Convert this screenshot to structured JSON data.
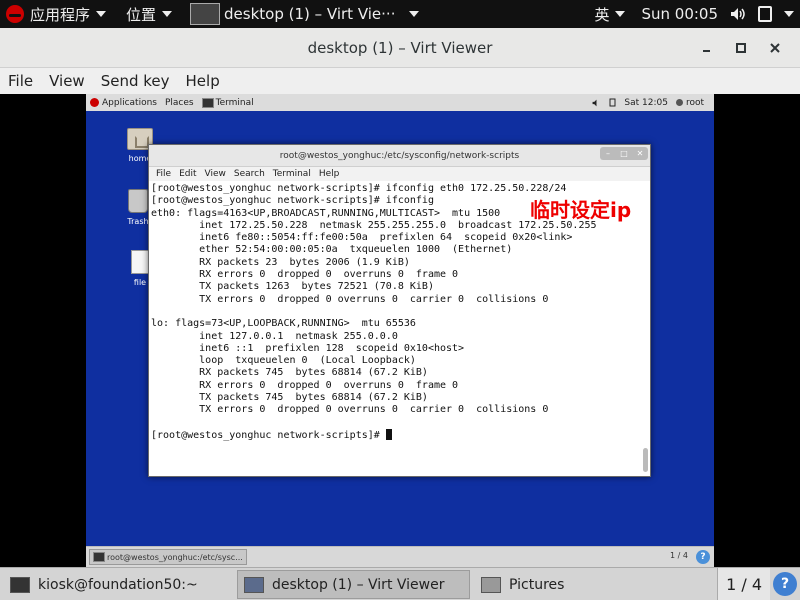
{
  "host_top": {
    "applications": "应用程序",
    "places": "位置",
    "window_title": "desktop (1) – Virt Vie···",
    "input_method": "英",
    "clock": "Sun 00:05"
  },
  "viewer": {
    "title": "desktop (1) – Virt Viewer",
    "menu": [
      "File",
      "View",
      "Send key",
      "Help"
    ]
  },
  "guest_top": {
    "applications": "Applications",
    "places": "Places",
    "task": "Terminal",
    "clock": "Sat 12:05",
    "user": "root"
  },
  "desktop_icons": [
    "home",
    "Trash",
    "file"
  ],
  "terminal": {
    "title": "root@westos_yonghuc:/etc/sysconfig/network-scripts",
    "menu": [
      "File",
      "Edit",
      "View",
      "Search",
      "Terminal",
      "Help"
    ],
    "lines": [
      "[root@westos_yonghuc network-scripts]# ifconfig eth0 172.25.50.228/24",
      "[root@westos_yonghuc network-scripts]# ifconfig",
      "eth0: flags=4163<UP,BROADCAST,RUNNING,MULTICAST>  mtu 1500",
      "        inet 172.25.50.228  netmask 255.255.255.0  broadcast 172.25.50.255",
      "        inet6 fe80::5054:ff:fe00:50a  prefixlen 64  scopeid 0x20<link>",
      "        ether 52:54:00:00:05:0a  txqueuelen 1000  (Ethernet)",
      "        RX packets 23  bytes 2006 (1.9 KiB)",
      "        RX errors 0  dropped 0  overruns 0  frame 0",
      "        TX packets 1263  bytes 72521 (70.8 KiB)",
      "        TX errors 0  dropped 0 overruns 0  carrier 0  collisions 0",
      "",
      "lo: flags=73<UP,LOOPBACK,RUNNING>  mtu 65536",
      "        inet 127.0.0.1  netmask 255.0.0.0",
      "        inet6 ::1  prefixlen 128  scopeid 0x10<host>",
      "        loop  txqueuelen 0  (Local Loopback)",
      "        RX packets 745  bytes 68814 (67.2 KiB)",
      "        RX errors 0  dropped 0  overruns 0  frame 0",
      "        TX packets 745  bytes 68814 (67.2 KiB)",
      "        TX errors 0  dropped 0 overruns 0  carrier 0  collisions 0",
      "",
      "[root@westos_yonghuc network-scripts]# "
    ],
    "annotation": "临时设定ip"
  },
  "guest_bottom": {
    "task": "root@westos_yonghuc:/etc/sysc...",
    "pager": "1 / 4",
    "help": "?"
  },
  "host_bottom": {
    "tasks": [
      "kiosk@foundation50:~",
      "desktop (1) – Virt Viewer",
      "Pictures"
    ],
    "pager": "1 / 4",
    "help": "?"
  },
  "colors": {
    "guest_desktop": "#0f2fa0",
    "annotation": "#e00000",
    "redhat": "#cc0000"
  },
  "icons": [
    "redhat-icon",
    "speaker-icon",
    "clipboard-icon",
    "close-icon",
    "minimize-icon",
    "maximize-icon",
    "terminal-icon",
    "folder-icon",
    "trash-icon",
    "file-icon",
    "help-icon"
  ]
}
